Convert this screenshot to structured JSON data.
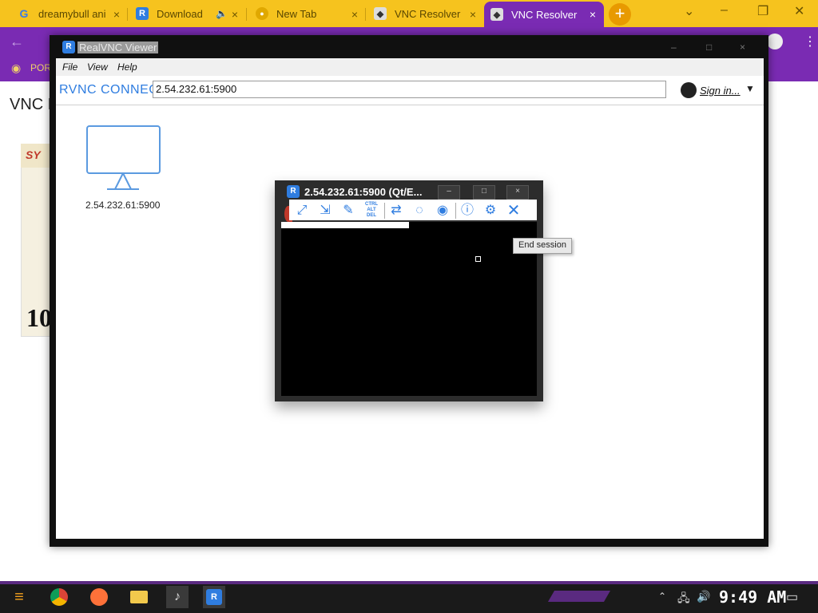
{
  "browser": {
    "tabs": [
      {
        "label": "dreamybull ani",
        "icon": "google-icon"
      },
      {
        "label": "Download",
        "icon": "realvnc-icon"
      },
      {
        "label": "New Tab",
        "icon": "chrome-icon"
      },
      {
        "label": "VNC Resolver",
        "icon": "vnc-resolver-icon"
      },
      {
        "label": "VNC Resolver",
        "icon": "vnc-resolver-icon"
      }
    ],
    "new_tab": "+",
    "bookmark_label": "POR",
    "page_title": "VNC Re",
    "side_text": "10",
    "side_logo": "SY"
  },
  "vnc_viewer": {
    "title": "RealVNC Viewer",
    "menu": [
      "File",
      "View",
      "Help"
    ],
    "logo": "RVNC CONNECT",
    "address": "2.54.232.61:5900",
    "sign_in": "Sign in...",
    "computer_label": "2.54.232.61:5900"
  },
  "session": {
    "title": "2.54.232.61:5900 (Qt/E...",
    "minimize": "–",
    "maximize": "□",
    "close": "×",
    "tooltip": "End session",
    "toolbar_ctrl": "CTRL ALT DEL"
  },
  "taskbar": {
    "clock": "9:49 AM"
  },
  "colors": {
    "tab_strip": "#f6c31e",
    "browser_accent": "#7a2bb3",
    "vnc_blue": "#2f7de0"
  }
}
